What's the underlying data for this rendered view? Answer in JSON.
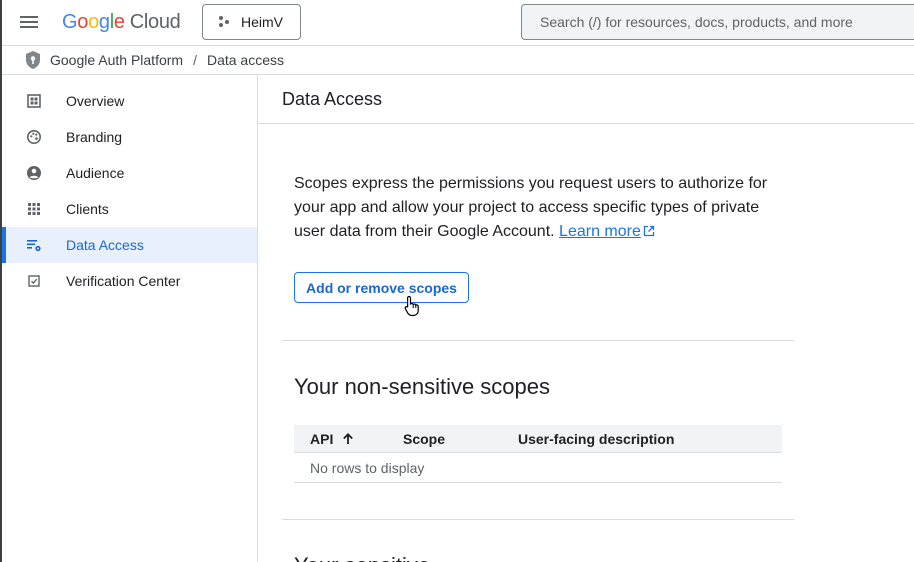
{
  "topbar": {
    "logo_word": "Google",
    "logo_product": "Cloud",
    "project_name": "HeimV",
    "search_placeholder": "Search (/) for resources, docs, products, and more"
  },
  "breadcrumb": {
    "root": "Google Auth Platform",
    "separator": "/",
    "current": "Data access"
  },
  "sidebar": {
    "items": [
      {
        "label": "Overview",
        "icon": "dashboard-icon"
      },
      {
        "label": "Branding",
        "icon": "palette-icon"
      },
      {
        "label": "Audience",
        "icon": "account-circle-icon"
      },
      {
        "label": "Clients",
        "icon": "apps-grid-icon"
      },
      {
        "label": "Data Access",
        "icon": "list-settings-icon",
        "active": true
      },
      {
        "label": "Verification Center",
        "icon": "verified-checkbox-icon"
      }
    ]
  },
  "main": {
    "title": "Data Access",
    "description": "Scopes express the permissions you request users to authorize for your app and allow your project to access specific types of private user data from their Google Account.",
    "learn_more": "Learn more",
    "add_scopes_button": "Add or remove scopes",
    "non_sensitive": {
      "title": "Your non-sensitive scopes",
      "columns": [
        "API",
        "Scope",
        "User-facing description"
      ],
      "empty_text": "No rows to display"
    },
    "sensitive_title_partial": "Your sensitive"
  },
  "colors": {
    "accent": "#1a73e8",
    "active_bg": "#e8f0fe",
    "divider": "#dadce0"
  }
}
